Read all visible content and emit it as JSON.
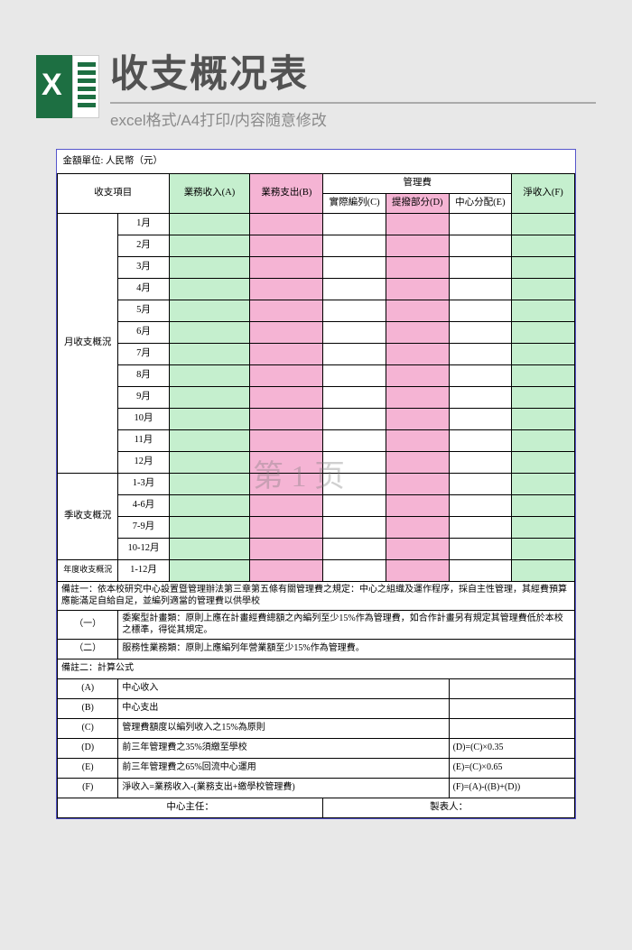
{
  "header": {
    "title": "收支概况表",
    "subtitle": "excel格式/A4打印/内容随意修改",
    "icon_letter": "X"
  },
  "unit_label": "金額單位: 人民幣（元）",
  "columns": {
    "item": "收支項目",
    "income": "業務收入(A)",
    "expense": "業務支出(B)",
    "mgmt_fee": "管理費",
    "actual": "實際編列(C)",
    "school": "提撥部分(D)",
    "center": "中心分配(E)",
    "net": "淨收入(F)"
  },
  "sections": {
    "monthly": {
      "label": "月收支概況",
      "rows": [
        "1月",
        "2月",
        "3月",
        "4月",
        "5月",
        "6月",
        "7月",
        "8月",
        "9月",
        "10月",
        "11月",
        "12月"
      ]
    },
    "quarterly": {
      "label": "季收支概況",
      "rows": [
        "1-3月",
        "4-6月",
        "7-9月",
        "10-12月"
      ]
    },
    "yearly": {
      "label": "年度收支概況",
      "rows": [
        "1-12月"
      ]
    }
  },
  "notes": {
    "note1_header": "備註一：依本校研究中心設置暨管理辦法第三章第五條有關管理費之規定：中心之組織及運作程序，採自主性管理，其經費預算應能滿足自給自足，並編列適當的管理費以供學校",
    "item1_label": "（一）",
    "item1_text": "委案型計畫類：原則上應在計畫經費總額之內編列至少15%作為管理費，如合作計畫另有規定其管理費低於本校之標準，得從其規定。",
    "item2_label": "（二）",
    "item2_text": "服務性業務類：原則上應編列年營業額至少15%作為管理費。",
    "note2_header": "備註二：計算公式",
    "formulas": [
      {
        "code": "(A)",
        "desc": "中心收入",
        "calc": ""
      },
      {
        "code": "(B)",
        "desc": "中心支出",
        "calc": ""
      },
      {
        "code": "(C)",
        "desc": "管理費額度以編列收入之15%為原則",
        "calc": ""
      },
      {
        "code": "(D)",
        "desc": "前三年管理費之35%須繳至學校",
        "calc": "(D)=(C)×0.35"
      },
      {
        "code": "(E)",
        "desc": "前三年管理費之65%回流中心運用",
        "calc": "(E)=(C)×0.65"
      },
      {
        "code": "(F)",
        "desc": "淨收入=業務收入-(業務支出+繳學校管理費)",
        "calc": "(F)=(A)-((B)+(D))"
      }
    ]
  },
  "signatures": {
    "director": "中心主任：",
    "preparer": "製表人："
  },
  "watermark_page": "第 1 页"
}
